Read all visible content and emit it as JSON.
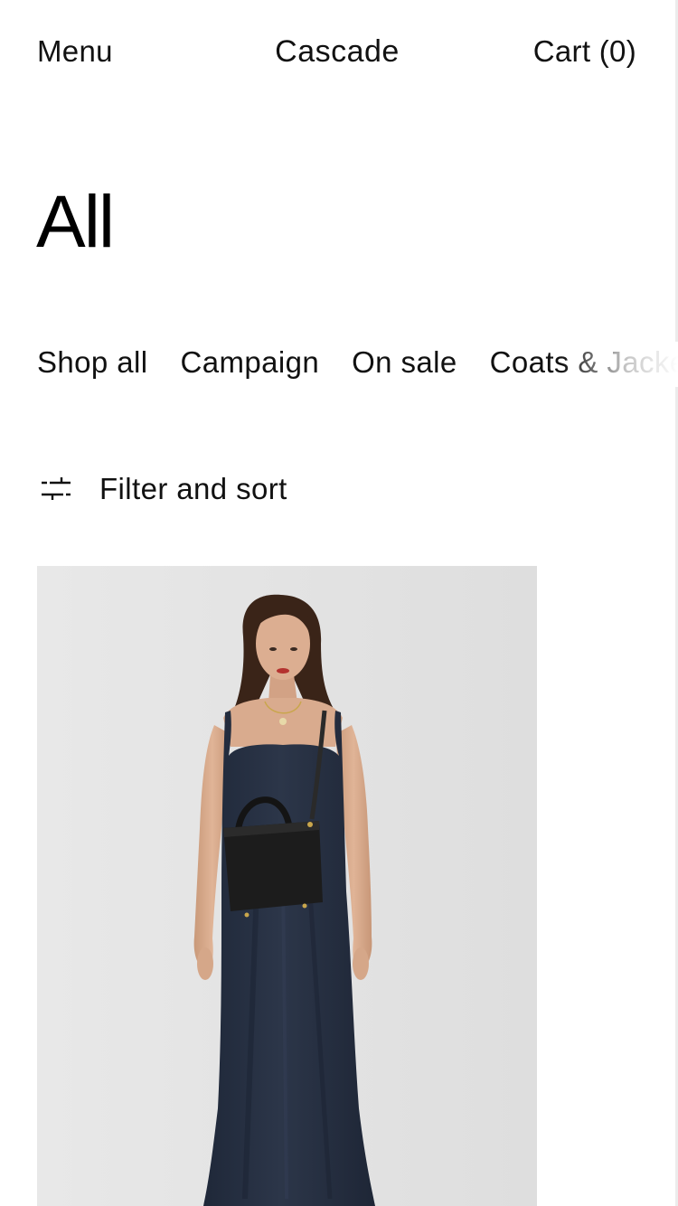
{
  "header": {
    "menu_label": "Menu",
    "brand": "Cascade",
    "cart_label": "Cart (0)"
  },
  "page": {
    "title": "All"
  },
  "collections": [
    {
      "label": "Shop all"
    },
    {
      "label": "Campaign"
    },
    {
      "label": "On sale"
    },
    {
      "label": "Coats & Jackets"
    }
  ],
  "filter": {
    "label": "Filter and sort",
    "icon": "sliders-icon"
  },
  "product": {
    "image": "product-photo",
    "colors": {
      "background": "#e6e6e6",
      "dress": "#283246",
      "bag": "#1c1c1c",
      "skin": "#d9ab8e",
      "hair": "#3a2418"
    }
  }
}
